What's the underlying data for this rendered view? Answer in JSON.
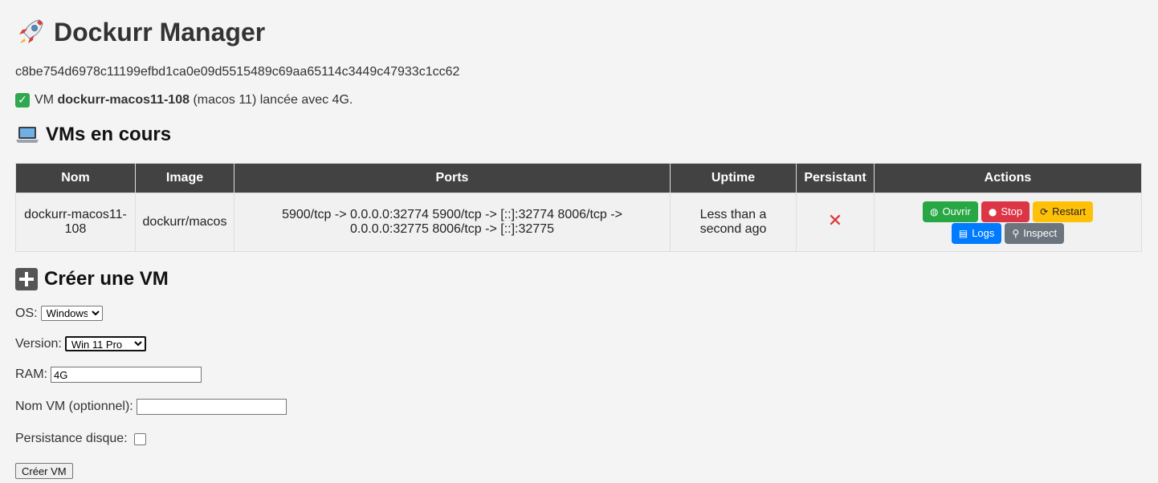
{
  "header": {
    "title": "Dockurr Manager",
    "container_id": "c8be754d6978c11199efbd1ca0e09d5515489c69aa65114c3449c47933c1cc62"
  },
  "flash": {
    "prefix": "VM",
    "vm_name": "dockurr-macos11-108",
    "suffix": "(macos 11) lancée avec 4G."
  },
  "vms_section": {
    "title": "VMs en cours",
    "columns": [
      "Nom",
      "Image",
      "Ports",
      "Uptime",
      "Persistant",
      "Actions"
    ],
    "rows": [
      {
        "name": "dockurr-macos11-108",
        "image": "dockurr/macos",
        "ports": "5900/tcp -> 0.0.0.0:32774 5900/tcp -> [::]:32774 8006/tcp -> 0.0.0.0:32775 8006/tcp -> [::]:32775",
        "uptime": "Less than a second ago",
        "persistent_icon": "cross-mark-icon",
        "actions": {
          "open": "Ouvrir",
          "stop": "Stop",
          "restart": "Restart",
          "logs": "Logs",
          "inspect": "Inspect"
        }
      }
    ]
  },
  "create_section": {
    "title": "Créer une VM",
    "os_label": "OS:",
    "os_value": "Windows",
    "version_label": "Version:",
    "version_value": "Win 11 Pro",
    "ram_label": "RAM:",
    "ram_value": "4G",
    "name_label": "Nom VM (optionnel):",
    "name_value": "",
    "persist_label": "Persistance disque:",
    "persist_checked": false,
    "submit_label": "Créer VM"
  },
  "colors": {
    "header_bg": "#424242",
    "green": "#28a745",
    "red": "#dc3545",
    "yellow": "#ffc107",
    "blue": "#007bff",
    "gray": "#6c757d"
  }
}
